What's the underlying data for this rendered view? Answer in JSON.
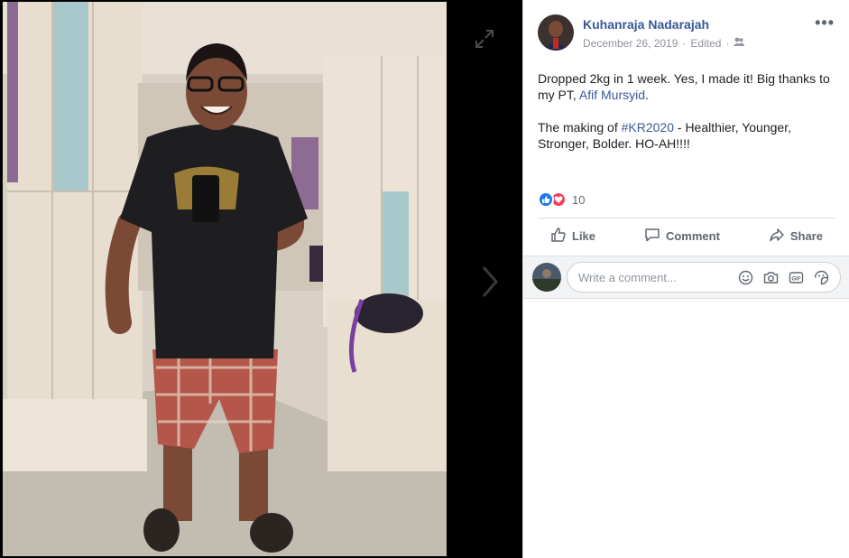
{
  "post": {
    "author": "Kuhanraja Nadarajah",
    "date": "December 26, 2019",
    "separator": "·",
    "edited": "Edited",
    "audience_icon": "friends-icon",
    "more_icon": "more-options-icon",
    "more_label": "•••",
    "text_line1_a": "Dropped 2kg in 1 week. Yes, I made it! Big thanks to my PT, ",
    "text_mention": "Afif Mursyid",
    "text_line1_b": ".",
    "text_line2_a": "The making of ",
    "text_hashtag": "#KR2020",
    "text_line2_b": " - Healthier, Younger, Stronger, Bolder. HO-AH!!!!"
  },
  "reactions": {
    "icons": [
      "like-reaction-icon",
      "love-reaction-icon"
    ],
    "count": "10"
  },
  "actions": {
    "like": "Like",
    "comment": "Comment",
    "share": "Share"
  },
  "comment": {
    "placeholder": "Write a comment...",
    "icons": [
      "emoji-icon",
      "camera-icon",
      "gif-icon",
      "sticker-icon"
    ]
  },
  "viewer": {
    "expand_icon": "expand-icon",
    "next_icon": "next-photo-icon"
  },
  "colors": {
    "link": "#385898",
    "meta": "#90949c",
    "like_blue": "#1877f2",
    "love_red": "#f33e58",
    "action_gray": "#606770"
  }
}
